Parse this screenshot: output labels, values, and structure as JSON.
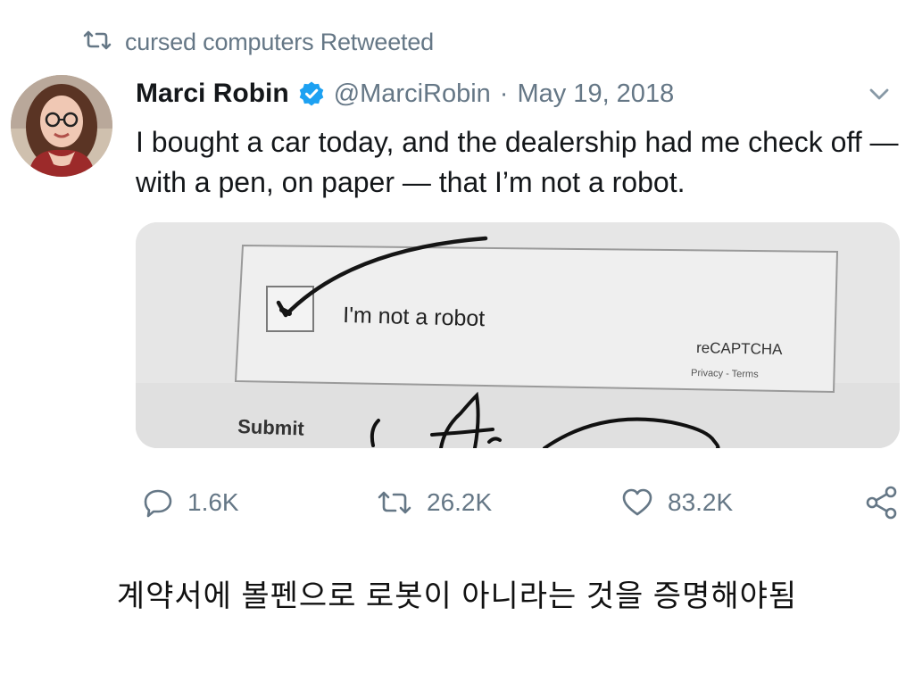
{
  "retweet": {
    "icon": "retweet-icon",
    "text": "cursed computers Retweeted"
  },
  "tweet": {
    "author_name": "Marci Robin",
    "handle": "@MarciRobin",
    "separator": "·",
    "date": "May 19, 2018",
    "text": "I bought a car today, and the dealership had me check off — with a pen, on paper — that I’m not a robot.",
    "avatar_icon": "avatar",
    "verified_icon": "verified-badge-icon",
    "menu_icon": "chevron-down-icon"
  },
  "media": {
    "checkbox_label": "I'm not a robot",
    "brand": "reCAPTCHA",
    "privacy_terms": "Privacy - Terms",
    "submit_label": "Submit"
  },
  "actions": {
    "replies": "1.6K",
    "retweets": "26.2K",
    "likes": "83.2K"
  },
  "caption": "계약서에 볼펜으로 로봇이 아니라는 것을 증명해야됨",
  "colors": {
    "text_primary": "#14171a",
    "text_secondary": "#657786",
    "verified_blue": "#1da1f2"
  }
}
